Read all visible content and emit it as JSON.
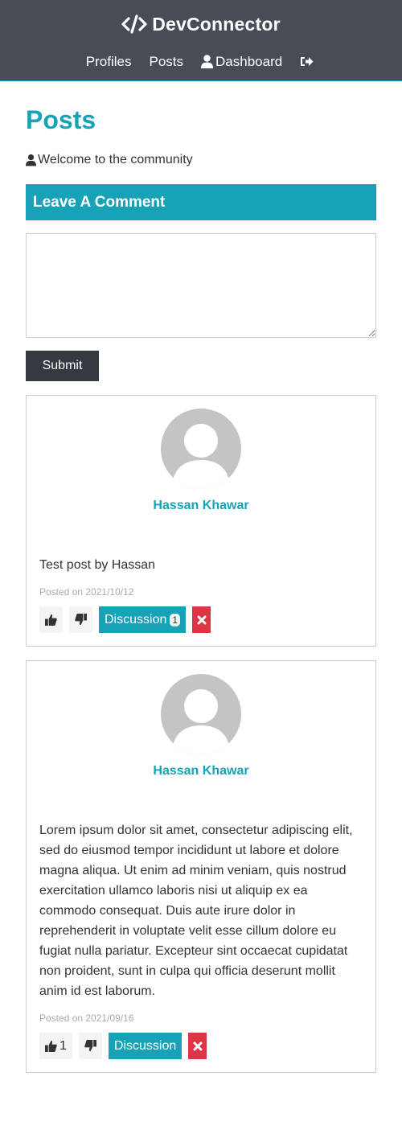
{
  "navbar": {
    "brand": "DevConnector",
    "links": {
      "profiles": "Profiles",
      "posts": "Posts",
      "dashboard": "Dashboard"
    },
    "icons": {
      "brand": "code-icon",
      "dashboard": "user-icon",
      "logout": "sign-out-icon"
    }
  },
  "page": {
    "title": "Posts",
    "lead": "Welcome to the community"
  },
  "comment_form": {
    "header": "Leave A Comment",
    "textarea_value": "",
    "submit_label": "Submit"
  },
  "posts": [
    {
      "author": "Hassan Khawar",
      "text": "Test post by Hassan",
      "date": "Posted on 2021/10/12",
      "likes": "",
      "discussion_label": "Discussion",
      "comments": "1"
    },
    {
      "author": "Hassan Khawar",
      "text": "Lorem ipsum dolor sit amet, consectetur adipiscing elit, sed do eiusmod tempor incididunt ut labore et dolore magna aliqua. Ut enim ad minim veniam, quis nostrud exercitation ullamco laboris nisi ut aliquip ex ea commodo consequat. Duis aute irure dolor in reprehenderit in voluptate velit esse cillum dolore eu fugiat nulla pariatur. Excepteur sint occaecat cupidatat non proident, sunt in culpa qui officia deserunt mollit anim id est laborum.",
      "date": "Posted on 2021/09/16",
      "likes": "1",
      "discussion_label": "Discussion",
      "comments": ""
    }
  ],
  "colors": {
    "primary": "#17a2b8",
    "dark": "#343a40",
    "navbar": "#474c55",
    "danger": "#dc3545",
    "light": "#f4f4f4"
  }
}
